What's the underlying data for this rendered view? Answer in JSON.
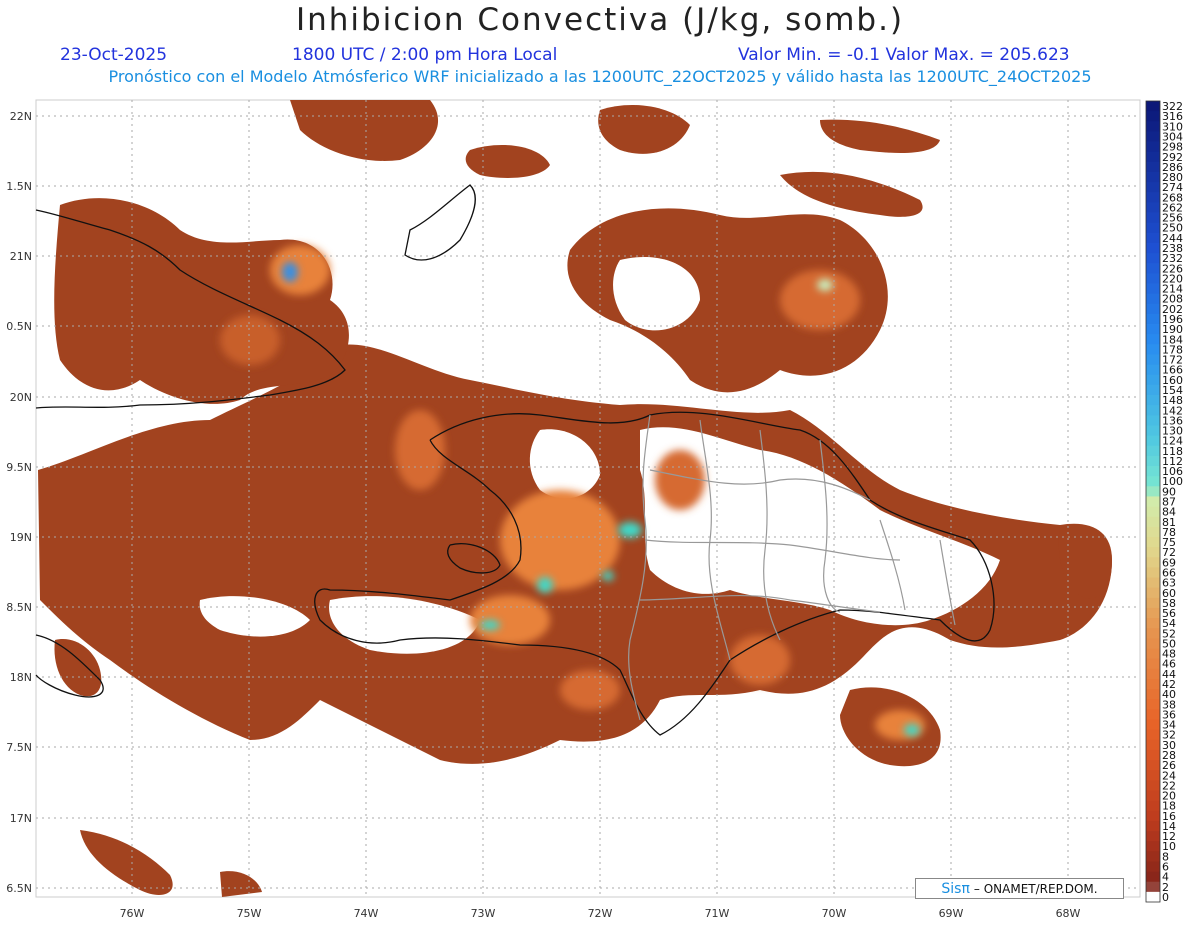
{
  "header": {
    "title": "Inhibicion Convectiva (J/kg, somb.)",
    "date": "23-Oct-2025",
    "time": "1800 UTC / 2:00 pm Hora Local",
    "min_max": "Valor Min. = -0.1  Valor Max. = 205.623",
    "description": "Pronóstico con el Modelo Atmósferico WRF inicializado a las 1200UTC_22OCT2025 y válido hasta las  1200UTC_24OCT2025"
  },
  "axes": {
    "lat_labels": [
      "22N",
      "1.5N",
      "21N",
      "0.5N",
      "20N",
      "9.5N",
      "19N",
      "8.5N",
      "18N",
      "7.5N",
      "17N",
      "6.5N"
    ],
    "lon_labels": [
      "76W",
      "75W",
      "74W",
      "73W",
      "72W",
      "71W",
      "70W",
      "69W",
      "68W"
    ]
  },
  "colorbar": {
    "labels": [
      "322",
      "316",
      "310",
      "304",
      "298",
      "292",
      "286",
      "280",
      "274",
      "268",
      "262",
      "256",
      "250",
      "244",
      "238",
      "232",
      "226",
      "220",
      "214",
      "208",
      "202",
      "196",
      "190",
      "184",
      "178",
      "172",
      "166",
      "160",
      "154",
      "148",
      "142",
      "136",
      "130",
      "124",
      "118",
      "112",
      "106",
      "100",
      "90",
      "87",
      "84",
      "81",
      "78",
      "75",
      "72",
      "69",
      "66",
      "63",
      "60",
      "58",
      "56",
      "54",
      "52",
      "50",
      "48",
      "46",
      "44",
      "42",
      "40",
      "38",
      "36",
      "34",
      "32",
      "30",
      "28",
      "26",
      "24",
      "22",
      "20",
      "18",
      "16",
      "14",
      "12",
      "10",
      "8",
      "6",
      "4",
      "2",
      "0"
    ]
  },
  "credit": {
    "brand": "Sisπ",
    "text": "– ONAMET/REP.DOM."
  },
  "colors": {
    "base": "#a2431f",
    "low_fill": "#b8522a",
    "mid": "#e8823a",
    "high": "#3fd8c8",
    "title_blue": "#2233dd",
    "desc_blue": "#1a8fe0"
  }
}
